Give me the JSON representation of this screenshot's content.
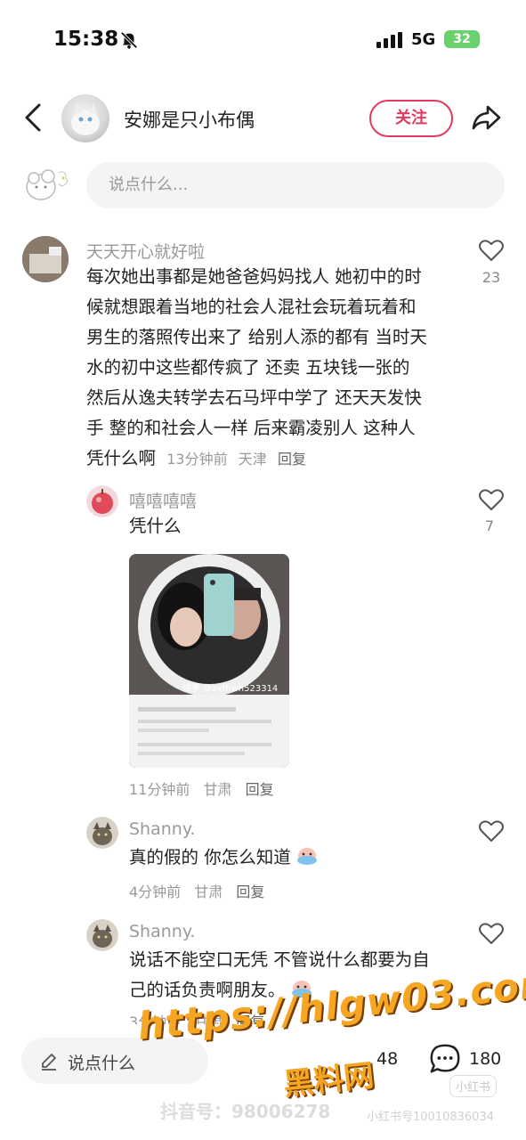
{
  "status": {
    "time": "15:38",
    "network": "5G",
    "battery": "32"
  },
  "header": {
    "author_name": "安娜是只小布偶",
    "follow_label": "关注"
  },
  "comment_box": {
    "placeholder": "说点什么..."
  },
  "comments": [
    {
      "name": "天天开心就好啦",
      "text_lines": [
        "每次她出事都是她爸爸妈妈找人 她初中的时",
        "候就想跟着当地的社会人混社会玩着玩着和",
        "男生的落照传出来了 给别人添的都有 当时天",
        "水的初中这些都传疯了 还卖 五块钱一张的",
        "然后从逸夫转学去石马坪中学了 还天天发快",
        "手 整的和社会人一样 后来霸凌别人 这种人"
      ],
      "last_line": "凭什么啊",
      "time": "13分钟前",
      "location": "天津",
      "reply": "回复",
      "likes": "23"
    },
    {
      "name": "嘻嘻嘻嘻",
      "text": "凭什么",
      "photo_caption": "快手 @zythwh523314",
      "time": "11分钟前",
      "location": "甘肃",
      "reply": "回复",
      "likes": "7"
    },
    {
      "name": "Shanny.",
      "text": "真的假的 你怎么知道",
      "time": "4分钟前",
      "location": "甘肃",
      "reply": "回复"
    },
    {
      "name": "Shanny.",
      "text_lines": [
        "说话不能空口无凭 不管说什么都要为自",
        "己的话负责啊朋友。"
      ],
      "time": "3分钟前",
      "location": "甘肃",
      "reply": "回复"
    }
  ],
  "bottom_bar": {
    "placeholder": "说点什么",
    "collects": "48",
    "comments": "180"
  },
  "watermarks": {
    "url": "https://hlgw03.com",
    "brand": "黑料网",
    "douyin": "抖音号：98006278",
    "xhs": "小红书",
    "xhs_id": "小红书号10010836034"
  },
  "colors": {
    "accent": "#e2395f",
    "watermark": "#f5a623"
  },
  "icons": [
    "bell-muted-icon",
    "signal-icon",
    "back-arrow-icon",
    "share-icon",
    "heart-icon",
    "pen-icon",
    "comment-bubble-icon"
  ]
}
